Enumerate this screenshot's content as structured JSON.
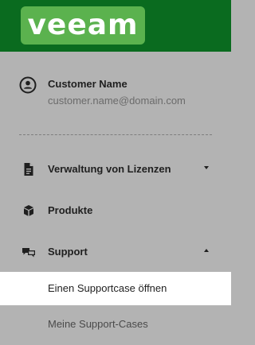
{
  "brand": {
    "logo_text": "veeam",
    "header_color": "#0a6b1f",
    "logo_color": "#5bb24e"
  },
  "user": {
    "icon": "user-circle-icon",
    "name": "Customer Name",
    "email": "customer.name@domain.com"
  },
  "nav": {
    "items": [
      {
        "label": "Verwaltung von Lizenzen",
        "icon": "document-icon",
        "expandable": true,
        "expanded": false
      },
      {
        "label": "Produkte",
        "icon": "box-icon",
        "expandable": false
      },
      {
        "label": "Support",
        "icon": "chat-icon",
        "expandable": true,
        "expanded": true
      }
    ],
    "support_subitems": [
      {
        "label": "Einen Supportcase öffnen",
        "active": true
      },
      {
        "label": "Meine Support-Cases",
        "active": false
      }
    ]
  }
}
